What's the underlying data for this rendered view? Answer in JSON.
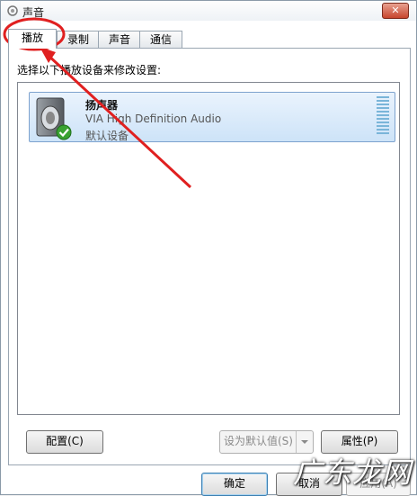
{
  "window": {
    "title": "声音",
    "close_glyph": "✕"
  },
  "tabs": [
    {
      "label": "播放",
      "active": true
    },
    {
      "label": "录制",
      "active": false
    },
    {
      "label": "声音",
      "active": false
    },
    {
      "label": "通信",
      "active": false
    }
  ],
  "instruction": "选择以下播放设备来修改设置:",
  "devices": [
    {
      "name": "扬声器",
      "driver": "VIA High Definition Audio",
      "status": "默认设备",
      "icon": "speaker-icon",
      "default_badge": "green-check-icon"
    }
  ],
  "buttons": {
    "configure": "配置(C)",
    "set_default": "设为默认值(S)",
    "properties": "属性(P)",
    "ok": "确定",
    "cancel": "取消",
    "apply": "应用(A)"
  },
  "watermark": "广东龙网",
  "colors": {
    "selection": "#cde3f8",
    "annotation": "#e02020",
    "check": "#3aa232"
  }
}
